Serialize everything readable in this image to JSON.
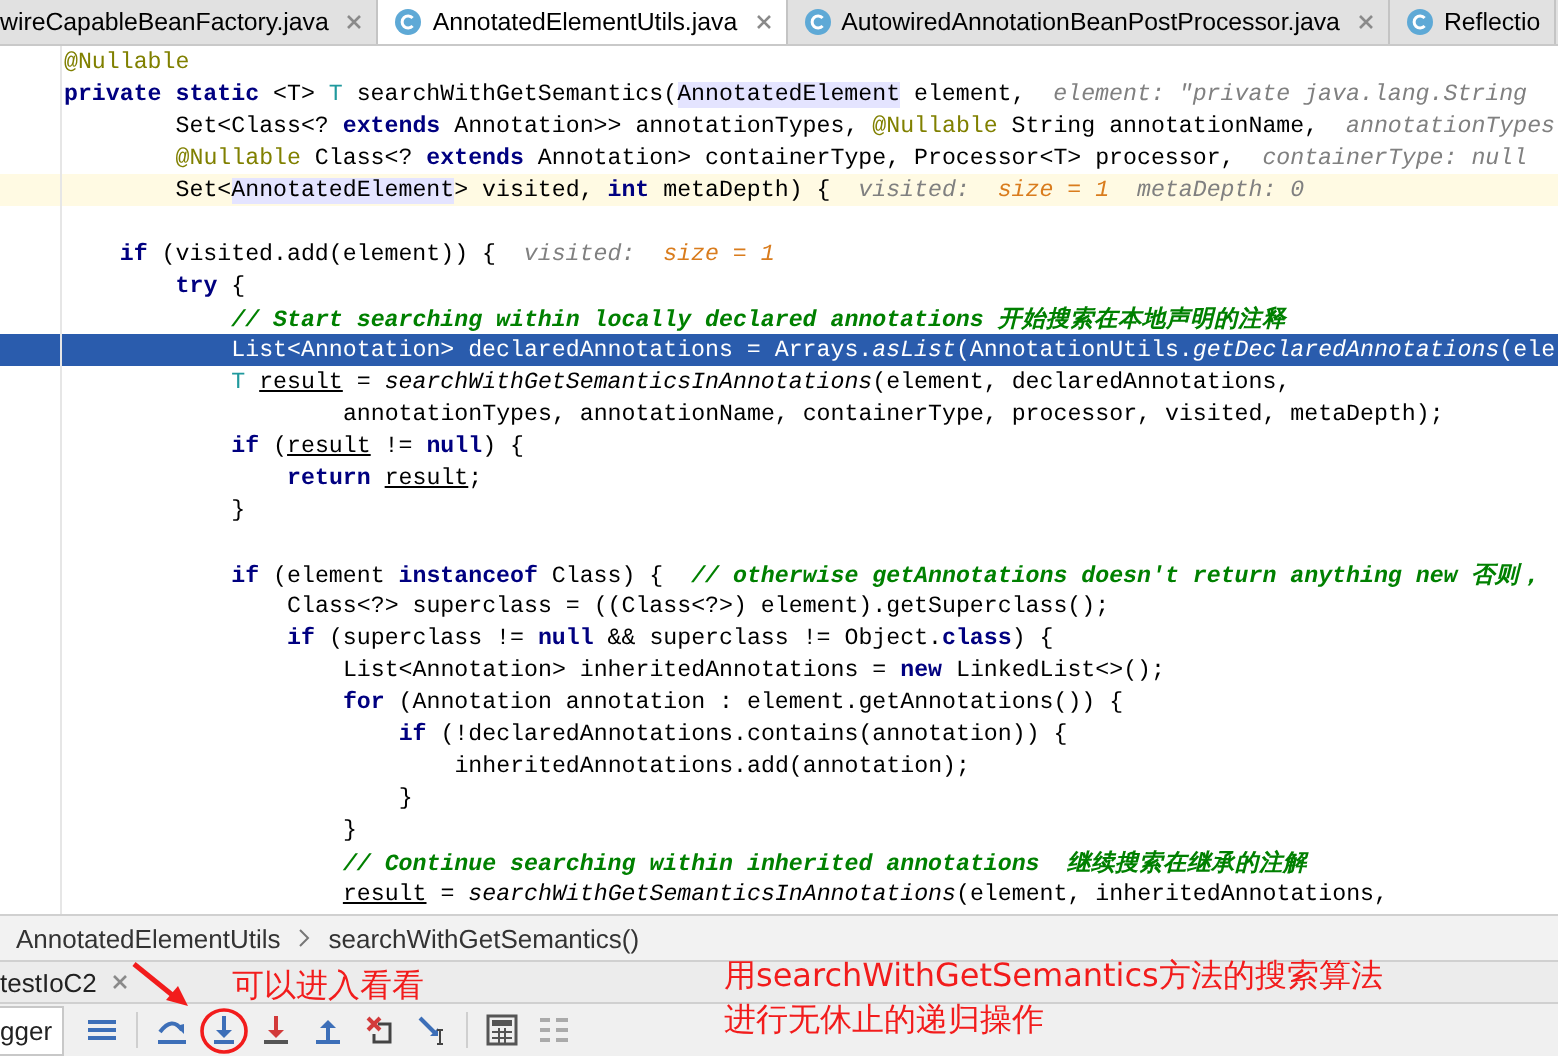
{
  "tabs": [
    {
      "label": "wireCapableBeanFactory.java",
      "icon": false,
      "close": true,
      "selected": false
    },
    {
      "label": "AnnotatedElementUtils.java",
      "icon": true,
      "close": true,
      "selected": true
    },
    {
      "label": "AutowiredAnnotationBeanPostProcessor.java",
      "icon": true,
      "close": true,
      "selected": false
    },
    {
      "label": "Reflectio",
      "icon": true,
      "close": false,
      "selected": false
    }
  ],
  "editor": {
    "lines": [
      {
        "kind": "normal",
        "code": [
          {
            "kind": "annotation",
            "text": "@Nullable"
          }
        ]
      },
      {
        "kind": "normal",
        "code": [
          {
            "kind": "keyword",
            "text": "private static "
          },
          {
            "kind": "plain",
            "text": "<T> "
          },
          {
            "kind": "type_param",
            "text": "T"
          },
          {
            "kind": "plain",
            "text": " searchWithGetSemantics("
          },
          {
            "kind": "usage",
            "text": "AnnotatedElement"
          },
          {
            "kind": "plain",
            "text": " element,"
          }
        ],
        "hint": [
          {
            "kind": "name",
            "text": "element: \"private java.lang.String"
          }
        ]
      },
      {
        "kind": "normal",
        "code": [
          {
            "kind": "plain",
            "text": "        Set<Class<? "
          },
          {
            "kind": "keyword",
            "text": "extends"
          },
          {
            "kind": "plain",
            "text": " Annotation>> annotationTypes, "
          },
          {
            "kind": "annotation",
            "text": "@Nullable"
          },
          {
            "kind": "plain",
            "text": " String annotationName,"
          }
        ],
        "hint": [
          {
            "kind": "name",
            "text": "annotationTypes"
          }
        ]
      },
      {
        "kind": "normal",
        "code": [
          {
            "kind": "annotation",
            "text": "        @Nullable"
          },
          {
            "kind": "plain",
            "text": " Class<? "
          },
          {
            "kind": "keyword",
            "text": "extends"
          },
          {
            "kind": "plain",
            "text": " Annotation> containerType, Processor<T> processor,"
          }
        ],
        "hint": [
          {
            "kind": "name",
            "text": "containerType: null"
          }
        ]
      },
      {
        "kind": "caret",
        "code": [
          {
            "kind": "plain",
            "text": "        Set<"
          },
          {
            "kind": "usage",
            "text": "AnnotatedElement"
          },
          {
            "kind": "plain",
            "text": "> visited, "
          },
          {
            "kind": "keyword",
            "text": "int"
          },
          {
            "kind": "plain",
            "text": " metaDepth) {"
          }
        ],
        "hint": [
          {
            "kind": "name",
            "text": "visited:  "
          },
          {
            "kind": "value",
            "text": "size = 1"
          },
          {
            "kind": "name",
            "text": "  metaDepth: 0"
          }
        ]
      },
      {
        "kind": "normal"
      },
      {
        "kind": "normal",
        "code": [
          {
            "kind": "keyword",
            "text": "    if"
          },
          {
            "kind": "plain",
            "text": " (visited.add(element)) {"
          }
        ],
        "hint": [
          {
            "kind": "name",
            "text": "visited:  "
          },
          {
            "kind": "value",
            "text": "size = 1"
          }
        ]
      },
      {
        "kind": "normal",
        "code": [
          {
            "kind": "keyword",
            "text": "        try"
          },
          {
            "kind": "plain",
            "text": " {"
          }
        ]
      },
      {
        "kind": "normal",
        "code": [
          {
            "kind": "comment",
            "text": "            // Start searching within locally declared annotations 开始搜索在本地声明的注释"
          }
        ]
      },
      {
        "kind": "execution",
        "code": [
          {
            "kind": "plain",
            "text": "            List<Annotation> declaredAnnotations = Arrays."
          },
          {
            "kind": "static",
            "text": "asList"
          },
          {
            "kind": "plain",
            "text": "(AnnotationUtils."
          },
          {
            "kind": "static",
            "text": "getDeclaredAnnotations"
          },
          {
            "kind": "plain",
            "text": "(ele"
          }
        ]
      },
      {
        "kind": "normal",
        "code": [
          {
            "kind": "type_param",
            "text": "            T "
          },
          {
            "kind": "reassigned",
            "text": "result"
          },
          {
            "kind": "plain",
            "text": " = "
          },
          {
            "kind": "static",
            "text": "searchWithGetSemanticsInAnnotations"
          },
          {
            "kind": "plain",
            "text": "(element, declaredAnnotations,"
          }
        ]
      },
      {
        "kind": "normal",
        "code": [
          {
            "kind": "plain",
            "text": "                    annotationTypes, annotationName, containerType, processor, visited, metaDepth);"
          }
        ]
      },
      {
        "kind": "normal",
        "code": [
          {
            "kind": "keyword",
            "text": "            if"
          },
          {
            "kind": "plain",
            "text": " ("
          },
          {
            "kind": "reassigned",
            "text": "result"
          },
          {
            "kind": "plain",
            "text": " != "
          },
          {
            "kind": "keyword",
            "text": "null"
          },
          {
            "kind": "plain",
            "text": ") {"
          }
        ]
      },
      {
        "kind": "normal",
        "code": [
          {
            "kind": "keyword",
            "text": "                return "
          },
          {
            "kind": "reassigned",
            "text": "result"
          },
          {
            "kind": "plain",
            "text": ";"
          }
        ]
      },
      {
        "kind": "normal",
        "code": [
          {
            "kind": "plain",
            "text": "            }"
          }
        ]
      },
      {
        "kind": "normal"
      },
      {
        "kind": "normal",
        "code": [
          {
            "kind": "keyword",
            "text": "            if"
          },
          {
            "kind": "plain",
            "text": " (element "
          },
          {
            "kind": "keyword",
            "text": "instanceof"
          },
          {
            "kind": "plain",
            "text": " Class) {  "
          },
          {
            "kind": "comment",
            "text": "// otherwise getAnnotations doesn't return anything new 否则，"
          }
        ]
      },
      {
        "kind": "normal",
        "code": [
          {
            "kind": "plain",
            "text": "                Class<?> superclass = ((Class<?>) element).getSuperclass();"
          }
        ]
      },
      {
        "kind": "normal",
        "code": [
          {
            "kind": "keyword",
            "text": "                if"
          },
          {
            "kind": "plain",
            "text": " (superclass != "
          },
          {
            "kind": "keyword",
            "text": "null"
          },
          {
            "kind": "plain",
            "text": " && superclass != Object."
          },
          {
            "kind": "keyword",
            "text": "class"
          },
          {
            "kind": "plain",
            "text": ") {"
          }
        ]
      },
      {
        "kind": "normal",
        "code": [
          {
            "kind": "plain",
            "text": "                    List<Annotation> inheritedAnnotations = "
          },
          {
            "kind": "keyword",
            "text": "new"
          },
          {
            "kind": "plain",
            "text": " LinkedList<>();"
          }
        ]
      },
      {
        "kind": "normal",
        "code": [
          {
            "kind": "keyword",
            "text": "                    for"
          },
          {
            "kind": "plain",
            "text": " (Annotation annotation : element.getAnnotations()) {"
          }
        ]
      },
      {
        "kind": "normal",
        "code": [
          {
            "kind": "keyword",
            "text": "                        if"
          },
          {
            "kind": "plain",
            "text": " (!declaredAnnotations.contains(annotation)) {"
          }
        ]
      },
      {
        "kind": "normal",
        "code": [
          {
            "kind": "plain",
            "text": "                            inheritedAnnotations.add(annotation);"
          }
        ]
      },
      {
        "kind": "normal",
        "code": [
          {
            "kind": "plain",
            "text": "                        }"
          }
        ]
      },
      {
        "kind": "normal",
        "code": [
          {
            "kind": "plain",
            "text": "                    }"
          }
        ]
      },
      {
        "kind": "normal",
        "code": [
          {
            "kind": "comment",
            "text": "                    // Continue searching within inherited annotations  继续搜索在继承的注解"
          }
        ]
      },
      {
        "kind": "normal",
        "code": [
          {
            "kind": "reassigned",
            "text": "                    result"
          },
          {
            "kind": "plain",
            "text": " = "
          },
          {
            "kind": "static",
            "text": "searchWithGetSemanticsInAnnotations"
          },
          {
            "kind": "plain",
            "text": "(element, inheritedAnnotations,"
          }
        ]
      }
    ]
  },
  "breadcrumbs": [
    "AnnotatedElementUtils",
    "searchWithGetSemantics()"
  ],
  "debug_tab": {
    "label": "testIoC2",
    "close": true
  },
  "debugger_tab": {
    "label": "gger"
  },
  "notes": {
    "arrow_note": "可以进入看看",
    "side_note": [
      "用searchWithGetSemantics方法的搜索算法",
      "进行无休止的递归操作"
    ]
  }
}
